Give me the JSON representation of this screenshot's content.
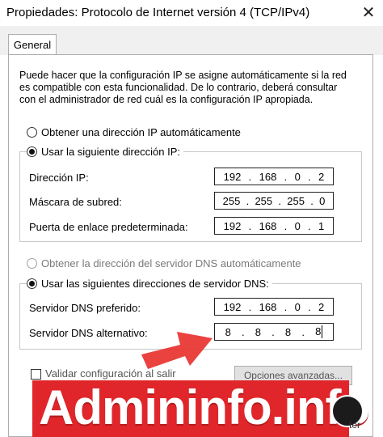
{
  "window": {
    "title": "Propiedades: Protocolo de Internet versión 4 (TCP/IPv4)",
    "close_glyph": "✕"
  },
  "tabs": [
    {
      "label": "General"
    }
  ],
  "description": "Puede hacer que la configuración IP se asigne automáticamente si la red es compatible con esta funcionalidad. De lo contrario, deberá consultar con el administrador de red cuál es la configuración IP apropiada.",
  "ip_section": {
    "auto_label": "Obtener una dirección IP automáticamente",
    "manual_label": "Usar la siguiente dirección IP:",
    "fields": [
      {
        "label": "Dirección IP:",
        "octets": [
          "192",
          "168",
          "0",
          "2"
        ]
      },
      {
        "label": "Máscara de subred:",
        "octets": [
          "255",
          "255",
          "255",
          "0"
        ]
      },
      {
        "label": "Puerta de enlace predeterminada:",
        "octets": [
          "192",
          "168",
          "0",
          "1"
        ]
      }
    ]
  },
  "dns_section": {
    "auto_label": "Obtener la dirección del servidor DNS automáticamente",
    "manual_label": "Usar las siguientes direcciones de servidor DNS:",
    "fields": [
      {
        "label": "Servidor DNS preferido:",
        "octets": [
          "192",
          "168",
          "0",
          "2"
        ]
      },
      {
        "label": "Servidor DNS alternativo:",
        "octets": [
          "8",
          "8",
          "8",
          "8"
        ]
      }
    ]
  },
  "footer": {
    "validate_label": "Validar configuración al salir",
    "advanced_label": "Opciones avanzadas...",
    "ok_partial": "ter"
  },
  "watermark": {
    "text": "Admininfo.info",
    "color": "#e0262a"
  },
  "colors": {
    "accent_red": "#e0262a",
    "arrow_red": "#e8322f"
  }
}
